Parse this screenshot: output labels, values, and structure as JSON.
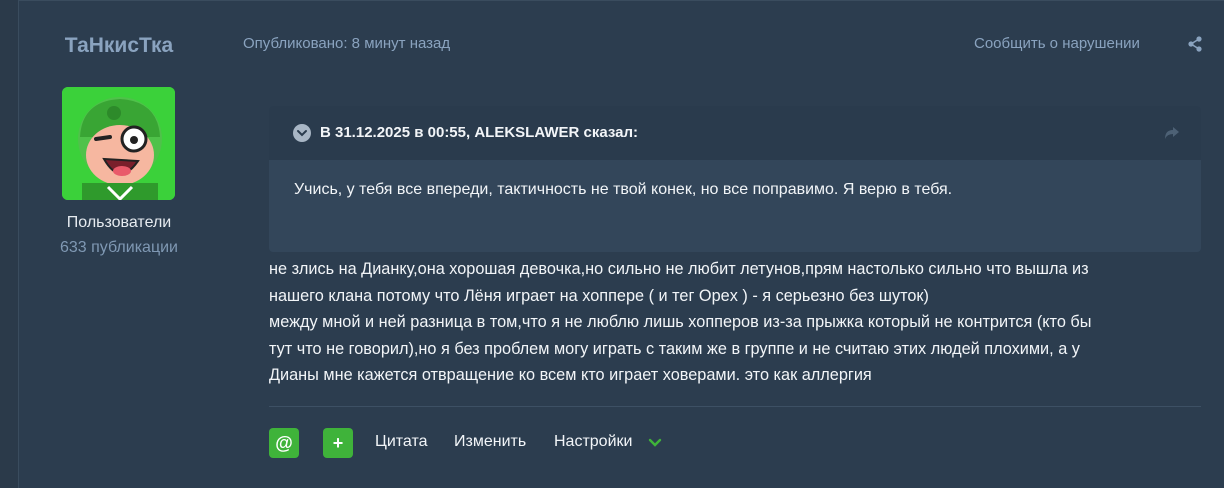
{
  "author": {
    "username": "ТаНкисТка",
    "group": "Пользователи",
    "posts_count": "633 публикации"
  },
  "post": {
    "published": "Опубликовано: 8 минут назад",
    "report": "Сообщить о нарушении",
    "quote": {
      "title": "В 31.12.2025 в 00:55, ALEKSLAWER сказал:",
      "text": "Учись, у тебя все впереди, тактичность не твой конек, но все поправимо. Я верю в тебя."
    },
    "lines": [
      "не злись на Дианку,она хорошая девочка,но сильно не любит летунов,прям настолько сильно что вышла из",
      "нашего клана потому что Лёня играет на хоппере ( и тег Opex ) - я серьезно без шуток)",
      "между мной и ней разница в том,что я не люблю лишь хопперов  из-за прыжка который не контрится (кто бы",
      "тут что не говорил),но я без проблем могу играть с таким же в группе и не считаю этих людей плохими, а у",
      "Дианы мне кажется отвращение ко  всем кто играет ховерами. это как аллергия"
    ]
  },
  "actions": {
    "mention_label": "@",
    "plus_label": "+",
    "quote_label": "Цитата",
    "edit_label": "Изменить",
    "settings_label": "Настройки"
  },
  "colors": {
    "background": "#2c3d4f",
    "quote_header": "#2a3b4d",
    "quote_body": "#33465a",
    "accent_green": "#3fb33a",
    "muted_blue": "#8aa3bf"
  },
  "icons": {
    "share": "share-icon",
    "quote_toggle": "chevron-down-circle-icon",
    "quote_link": "reply-arrow-icon",
    "settings_chevron": "chevron-down-icon"
  }
}
